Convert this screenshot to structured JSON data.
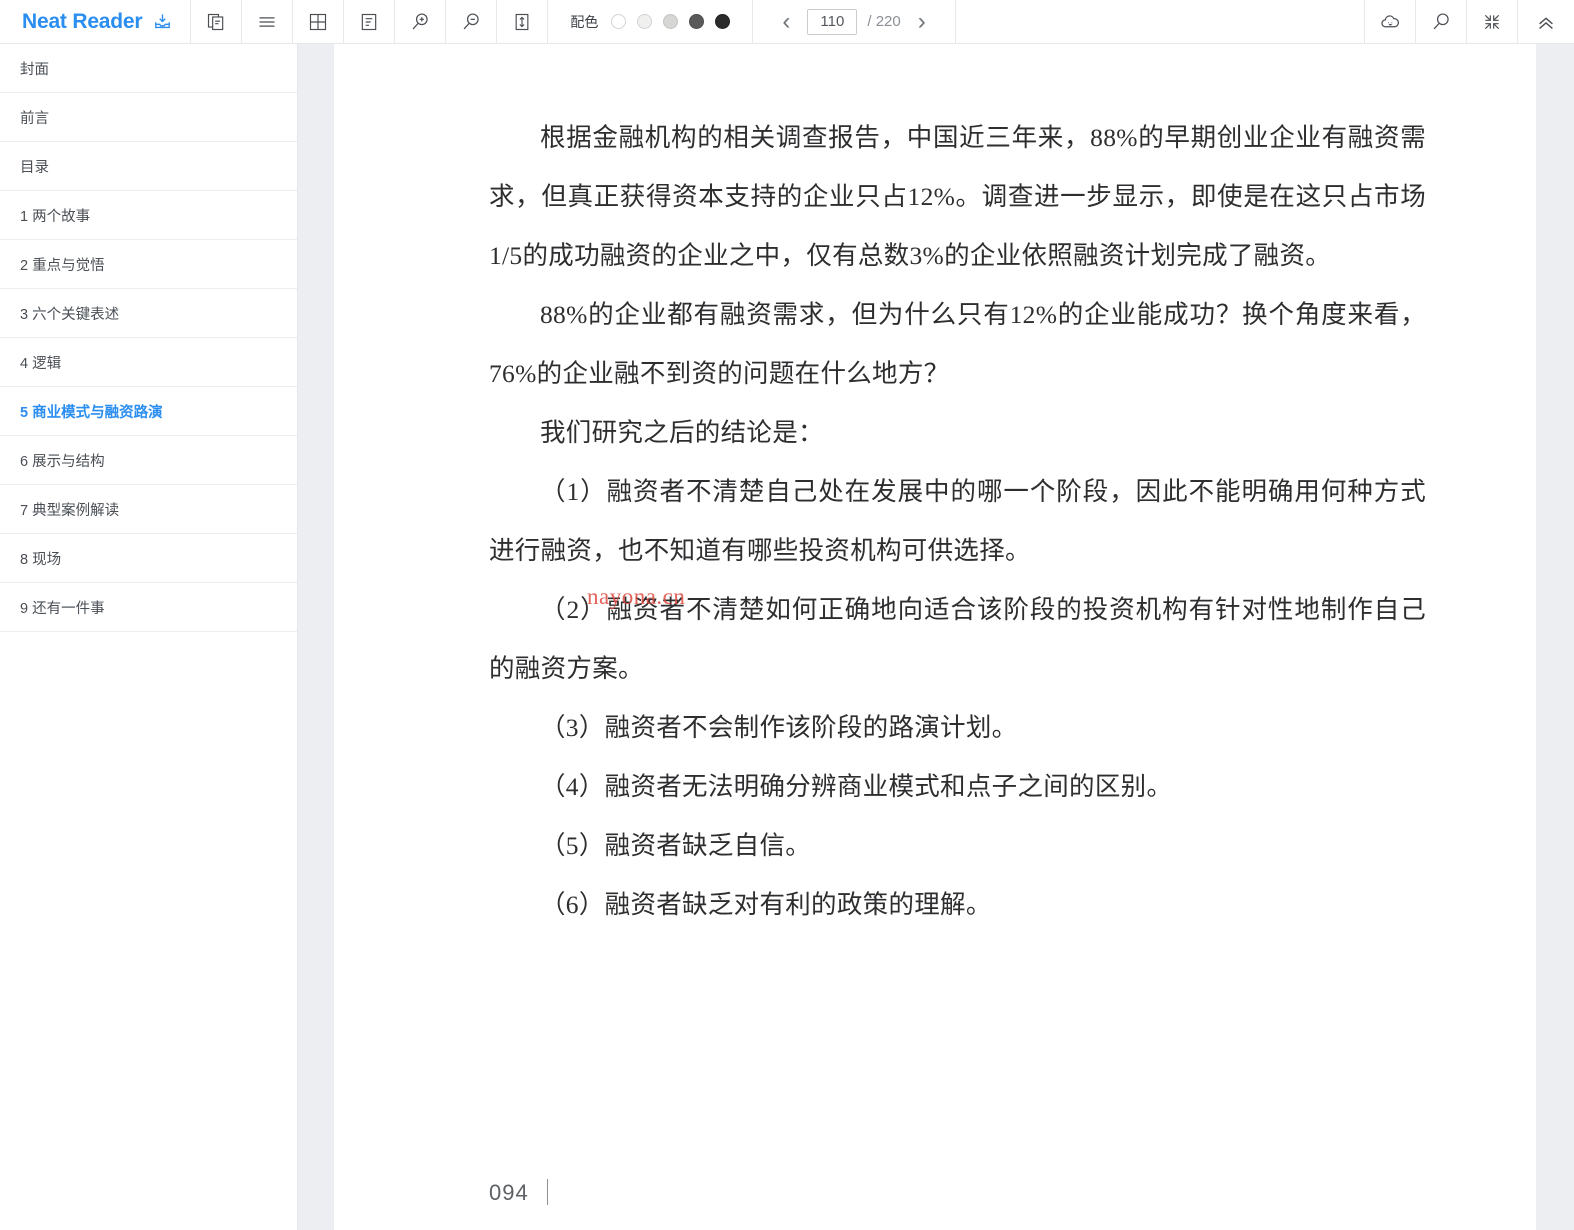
{
  "app": {
    "brand_name": "Neat Reader",
    "brand_icon": "download-tray-icon"
  },
  "toolbar": {
    "buttons": [
      {
        "name": "copy-pages-icon",
        "title": "双页"
      },
      {
        "name": "list-lines-icon",
        "title": "目录"
      },
      {
        "name": "grid-layout-icon",
        "title": "网格"
      },
      {
        "name": "note-panel-icon",
        "title": "笔记"
      },
      {
        "name": "zoom-in-icon",
        "title": "放大"
      },
      {
        "name": "zoom-out-icon",
        "title": "缩小"
      },
      {
        "name": "fit-height-icon",
        "title": "适应高度"
      }
    ],
    "color_scheme": {
      "label": "配色",
      "swatches": [
        "#ffffff",
        "#f0f0ee",
        "#d6d6d4",
        "#5a5a5a",
        "#2b2b2b"
      ],
      "selected_index": 0
    },
    "pager": {
      "prev_label": "‹",
      "next_label": "›",
      "current_page": "110",
      "total_label": "/ 220",
      "placeholder": "110"
    },
    "right_buttons": [
      {
        "name": "cloud-sync-icon",
        "title": "云同步"
      },
      {
        "name": "search-icon",
        "title": "搜索"
      },
      {
        "name": "collapse-icon",
        "title": "收起"
      },
      {
        "name": "chevron-up-icon",
        "title": "隐藏工具栏"
      }
    ]
  },
  "sidebar": {
    "items": [
      {
        "label": "封面",
        "active": false
      },
      {
        "label": "前言",
        "active": false
      },
      {
        "label": "目录",
        "active": false
      },
      {
        "label": "1 两个故事",
        "active": false
      },
      {
        "label": "2 重点与觉悟",
        "active": false
      },
      {
        "label": "3 六个关键表述",
        "active": false
      },
      {
        "label": "4 逻辑",
        "active": false
      },
      {
        "label": "5 商业模式与融资路演",
        "active": true
      },
      {
        "label": "6 展示与结构",
        "active": false
      },
      {
        "label": "7 典型案例解读",
        "active": false
      },
      {
        "label": "8 现场",
        "active": false
      },
      {
        "label": "9 还有一件事",
        "active": false
      }
    ]
  },
  "page": {
    "paragraphs": [
      "根据金融机构的相关调查报告，中国近三年来，88%的早期创业企业有融资需求，但真正获得资本支持的企业只占12%。调查进一步显示，即使是在这只占市场1/5的成功融资的企业之中，仅有总数3%的企业依照融资计划完成了融资。",
      "88%的企业都有融资需求，但为什么只有12%的企业能成功？换个角度来看，76%的企业融不到资的问题在什么地方？",
      "我们研究之后的结论是：",
      "（1）融资者不清楚自己处在发展中的哪一个阶段，因此不能明确用何种方式进行融资，也不知道有哪些投资机构可供选择。",
      "（2）融资者不清楚如何正确地向适合该阶段的投资机构有针对性地制作自己的融资方案。",
      "（3）融资者不会制作该阶段的路演计划。",
      "（4）融资者无法明确分辨商业模式和点子之间的区别。",
      "（5）融资者缺乏自信。",
      "（6）融资者缺乏对有利的政策的理解。"
    ],
    "watermark": "nayona.cn",
    "page_number": "094"
  },
  "colors": {
    "brand": "#2a8ef0",
    "active_toc": "#2a8ef0",
    "watermark": "#e0483f",
    "pane_background": "#eceef1",
    "text": "#2e2e30"
  }
}
